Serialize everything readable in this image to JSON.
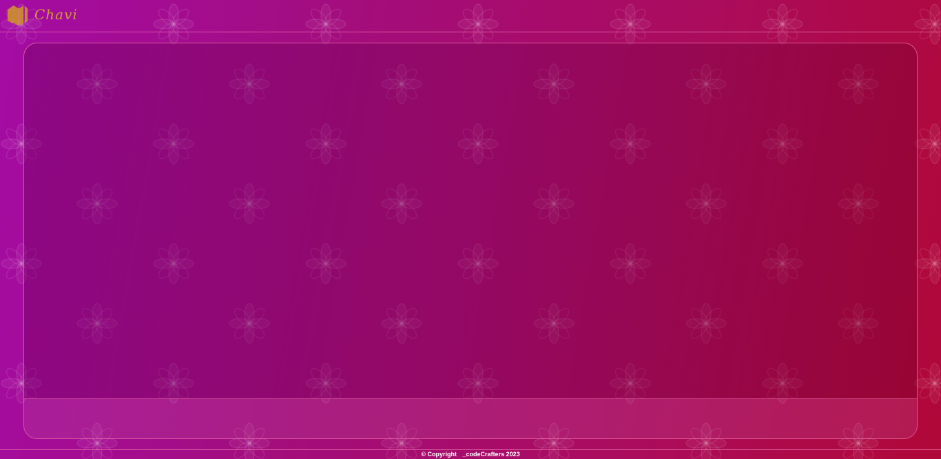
{
  "header": {
    "brand": "Chavi",
    "logo_icon": "chavi-logo-icon"
  },
  "footer": {
    "copyright": "© Copyright",
    "company": "_codeCrafters 2023"
  },
  "colors": {
    "brand_gold": "#d29a3a",
    "background_start": "#a40ca4",
    "background_end": "#b00838"
  }
}
